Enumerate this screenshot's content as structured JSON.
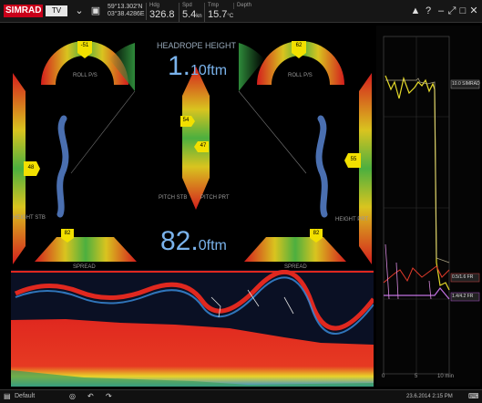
{
  "topbar": {
    "logo": "SIMRAD",
    "tv_label": "TV",
    "gps_line1": "59°13.302'N",
    "gps_line2": "03°38.4286E",
    "hdg_label": "Hdg",
    "hdg_value": "326.8",
    "spd_label": "Spd",
    "spd_value": "5.4",
    "spd_unit": "kn",
    "tmp_label": "Tmp",
    "tmp_value": "15.7",
    "tmp_unit": "°C",
    "depth_label": "Depth",
    "help_label": "?"
  },
  "trawl": {
    "headrope_title": "HEADROPE HEIGHT",
    "headrope_int": "1.",
    "headrope_dec": "10",
    "headrope_unit": "ftm",
    "depth_int": "82.",
    "depth_dec": "0",
    "depth_unit": "ftm",
    "port_roll_label": "ROLL P/S",
    "stbd_roll_label": "ROLL P/S",
    "port_roll_value": "-51",
    "stbd_roll_value": "62",
    "port_side_value": "48",
    "stbd_side_value": "55",
    "port_height_label": "HEIGHT STB",
    "stbd_height_label": "HEIGHT PRT",
    "pitch_label_left": "PITCH STB",
    "pitch_label_right": "PITCH PRT",
    "pitch_top_value": "54",
    "pitch_mid_value": "47",
    "spread_left_value": "82",
    "spread_right_value": "82",
    "spread_left_label": "SPREAD",
    "spread_right_label": "SPREAD"
  },
  "graph": {
    "legend_top": "10.0 SIMRAD",
    "legend_mid": "0.5/1.6 FR",
    "legend_low": "1.4/4.2 FR",
    "x_ticks": [
      "0",
      "5",
      "10 min"
    ]
  },
  "bottombar": {
    "left_label": "Default",
    "datetime": "23.6.2014 2:15 PM"
  },
  "colors": {
    "gauge_red": "#d41d1d",
    "gauge_yellow": "#d9c41f",
    "gauge_green": "#4caf3f",
    "readout_blue": "#7ab3ec",
    "marker_yellow": "#f2e000"
  }
}
